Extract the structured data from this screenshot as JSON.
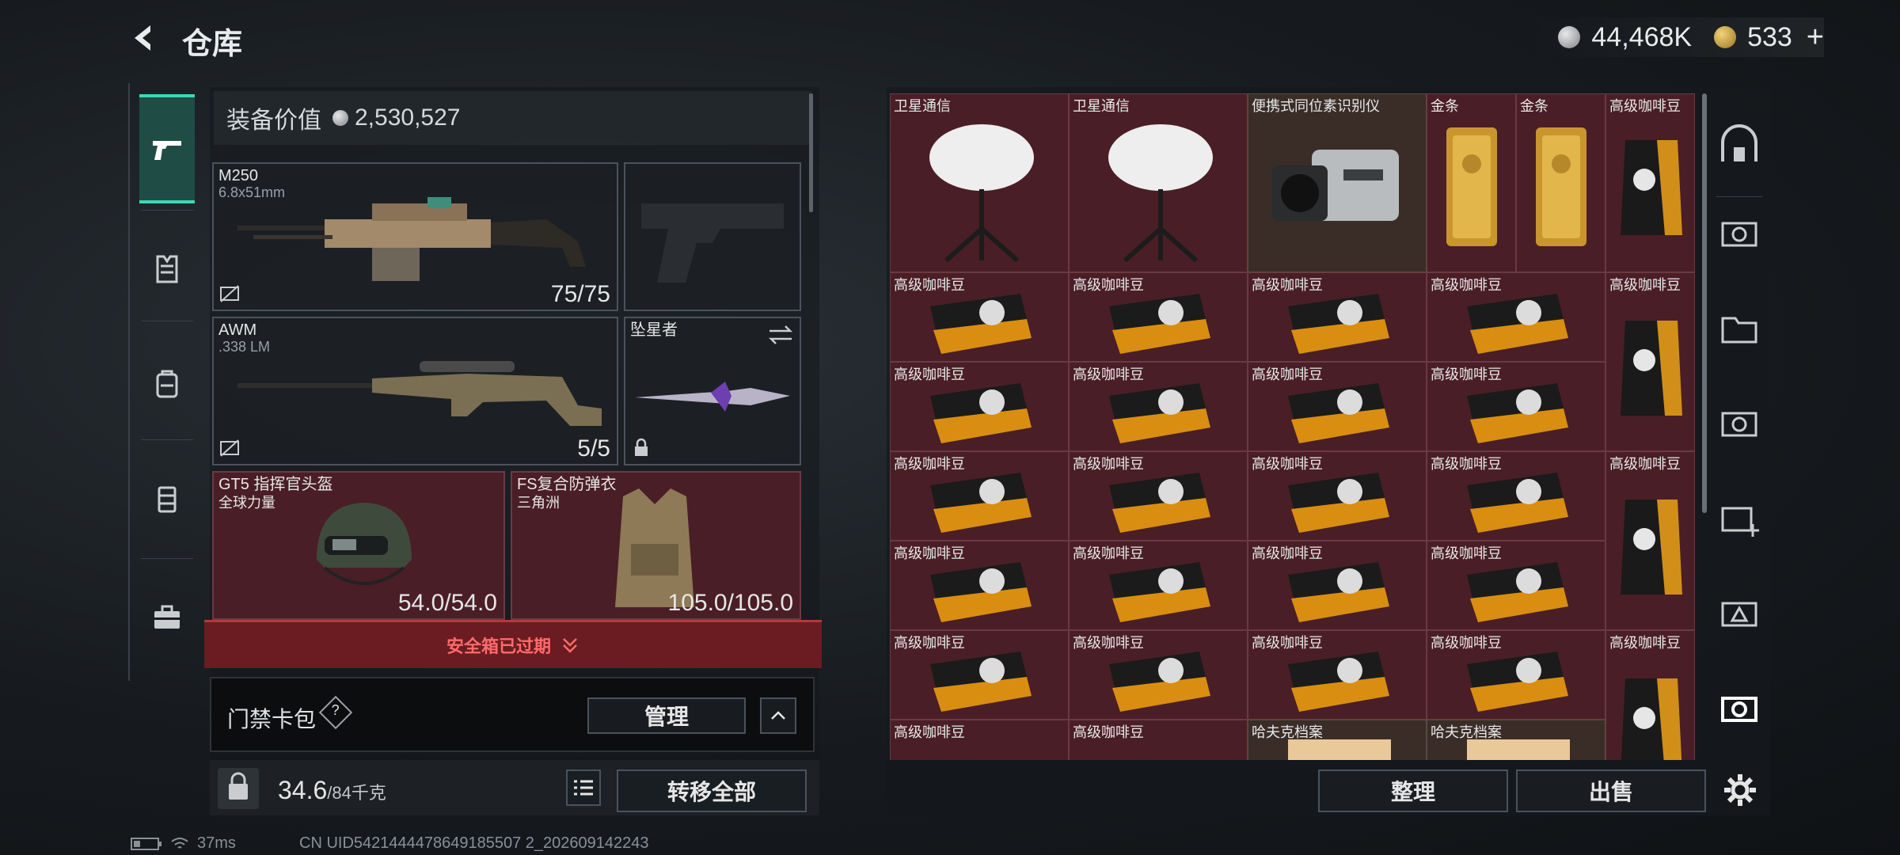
{
  "header": {
    "title": "仓库",
    "currency_silver": "44,468K",
    "currency_gold": "533",
    "plus": "+"
  },
  "loadout": {
    "equip_value_label": "装备价值",
    "equip_value": "2,530,527",
    "primary": {
      "name": "M250",
      "caliber": "6.8x51mm",
      "ammo": "75/75"
    },
    "secondary": {
      "name": "AWM",
      "caliber": ".338 LM",
      "ammo": "5/5"
    },
    "melee": {
      "name": "坠星者"
    },
    "helmet": {
      "name": "GT5 指挥官头盔",
      "sub": "全球力量",
      "durability": "54.0/54.0"
    },
    "armor": {
      "name": "FS复合防弹衣",
      "sub": "三角洲",
      "durability": "105.0/105.0"
    },
    "safe_box_expired": "安全箱已过期",
    "keycard_label": "门禁卡包",
    "keycard_help": "?",
    "manage_label": "管理",
    "weight_value": "34.6",
    "weight_max": "/84千克",
    "transfer_all_label": "转移全部"
  },
  "storage": {
    "items": {
      "sat": "卫星通信",
      "scanner": "便携式同位素识别仪",
      "gold": "金条",
      "coffee": "高级咖啡豆",
      "hafu": "哈夫克档案"
    },
    "sort_label": "整理",
    "sell_label": "出售"
  },
  "status": {
    "ping": "37ms",
    "uid": "CN UID5421444478649185507 2_202609142243"
  },
  "colors": {
    "accent": "#3ed7b6",
    "item_red": "#4a1e26",
    "expired_red": "#ff6a6a"
  }
}
